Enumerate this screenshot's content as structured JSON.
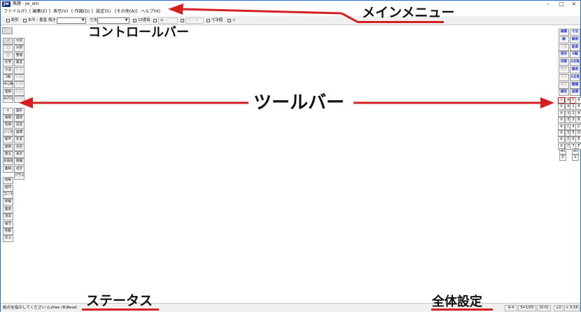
{
  "window": {
    "title": "無題 - jw_win",
    "app_icon_label": "Jw",
    "controls": [
      "–",
      "□",
      "×"
    ]
  },
  "menu": [
    "ファイル(F)",
    "[ 編集(E) ]",
    "表示(V)",
    "[ 作図(D) ]",
    "設定(S)",
    "[その他(A)]",
    "ヘルプ(H)"
  ],
  "controlbar": {
    "rect_label": "矩形",
    "hv_label": "水平・垂直",
    "tilt_label": "傾き",
    "dim_label": "寸法",
    "rubber_label": "15度毎",
    "dim_dot": "●----",
    "dim_arrow": "<---->",
    "dim_value_label": "寸法値",
    "lt_label": "<"
  },
  "left_toolbar": {
    "col1": [
      "/",
      "□",
      "○",
      "文字",
      "寸法",
      "2線",
      "中心線",
      "連線",
      "AUTO",
      "",
      "A",
      "複線",
      "包絡",
      "ハッチ",
      "建平",
      "建断",
      "建立",
      "多角形",
      "曲線",
      "",
      "接線",
      "接円",
      "コーナー",
      "伸縮",
      "面取",
      "消去",
      "複写",
      "移動",
      "戻る"
    ],
    "col2": [
      "",
      "",
      "",
      "",
      "",
      "",
      "",
      "",
      "",
      "",
      "",
      "",
      "",
      "",
      "",
      "",
      "",
      "",
      "",
      "",
      "",
      "",
      "",
      "",
      "",
      "",
      "",
      "",
      ""
    ],
    "col2b": [
      "",
      "文読",
      "分割",
      "整理",
      "属変",
      "BL化",
      "BL解",
      "BL属",
      "BL編",
      "BL終",
      "",
      "図形",
      "図登",
      "記変",
      "座標",
      "外変",
      "天空",
      "表計",
      "距離",
      "式計",
      "パラメ"
    ],
    "dim2b": [
      false,
      false,
      false,
      false,
      false,
      true,
      true,
      true,
      true,
      true,
      false,
      false,
      false,
      false,
      false,
      false,
      false,
      false,
      false,
      false,
      false
    ]
  },
  "right_toolbar": {
    "col1": [
      "線属",
      "線",
      "上線",
      "保存",
      "印刷",
      "範囲",
      "文字",
      "複写",
      "線色"
    ],
    "col2": [
      "寸法",
      "線角",
      "鉛直",
      "X軸",
      "2点角",
      "線長",
      "2点長",
      "間隔",
      "座標"
    ],
    "dim1": [
      false,
      false,
      true,
      false,
      false,
      true,
      true,
      true,
      false
    ],
    "layers_left": [
      "⓪",
      "①",
      "②",
      "③",
      "④",
      "⑤",
      "⑥",
      "⑦"
    ],
    "layers_left_b": [
      "⑧",
      "⑨",
      "Ⓐ",
      "Ⓑ",
      "Ⓒ",
      "Ⓓ",
      "Ⓔ",
      "Ⓕ"
    ],
    "layers_right": [
      "0",
      "1",
      "2",
      "3",
      "4",
      "5",
      "6",
      "7"
    ],
    "layers_right_b": [
      "8",
      "9",
      "A",
      "B",
      "C",
      "D",
      "E",
      "F"
    ],
    "all_label": "All",
    "all_value": "0",
    "close_label": "×"
  },
  "status": {
    "message": "始点を指示してください (L)free (R)Read",
    "paper": "A-4",
    "scale": "S=1/50",
    "layer": "[0-0]",
    "angle": "∠0",
    "zoom": "× 0.56"
  },
  "annotations": {
    "main_menu": "メインメニュー",
    "control_bar": "コントロールバー",
    "toolbar": "ツールバー",
    "status": "ステータス",
    "global_settings": "全体設定"
  },
  "colors": {
    "annotation_arrow": "#d42020",
    "accent_blue": "#1c2ccf",
    "title_blue": "#15307a"
  }
}
